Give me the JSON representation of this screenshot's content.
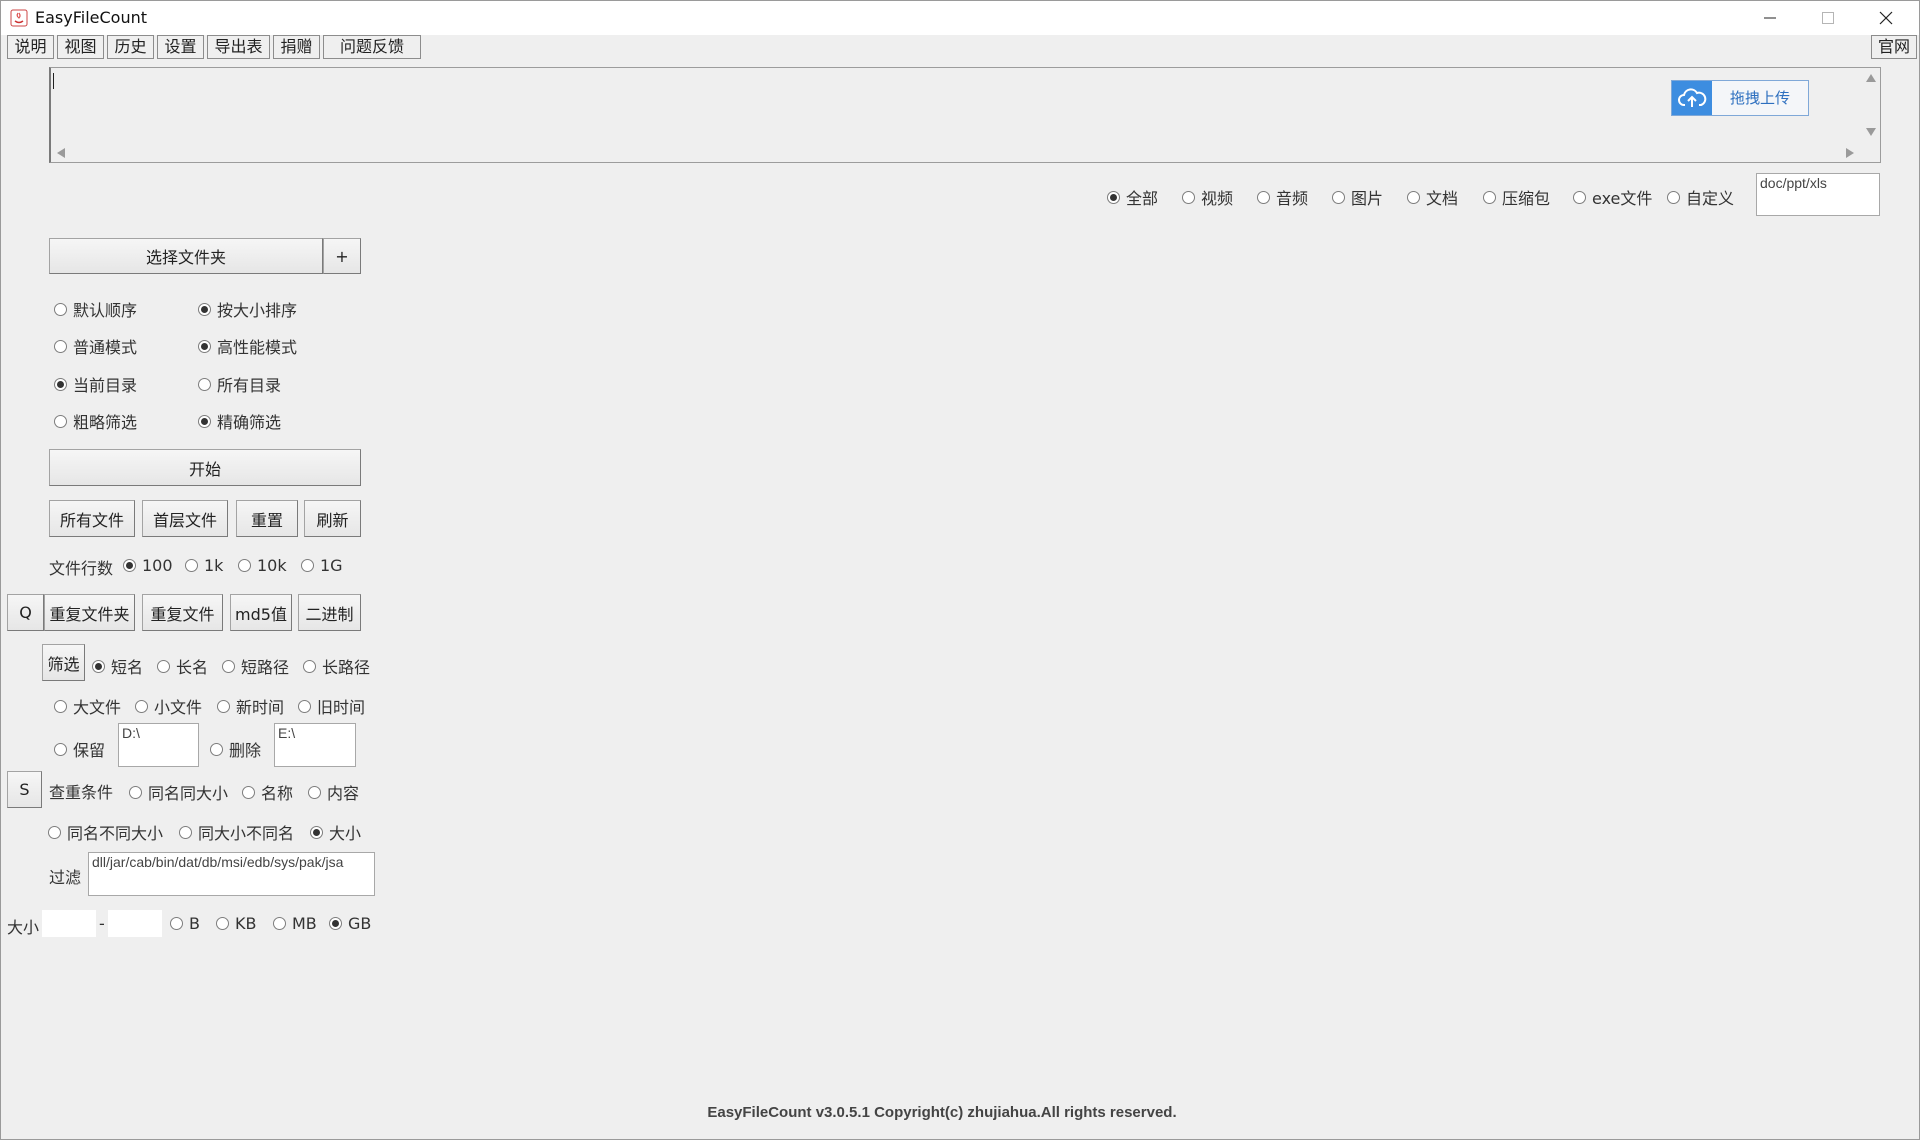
{
  "window": {
    "title": "EasyFileCount"
  },
  "menu": {
    "items": [
      "说明",
      "视图",
      "历史",
      "设置",
      "导出表",
      "捐赠",
      "问题反馈"
    ],
    "website": "官网"
  },
  "upload": {
    "button_label": "拖拽上传"
  },
  "filetype": {
    "options": [
      "全部",
      "视频",
      "音频",
      "图片",
      "文档",
      "压缩包",
      "exe文件",
      "自定义"
    ],
    "selected": "全部",
    "custom_value": "doc/ppt/xls"
  },
  "folder": {
    "select_label": "选择文件夹",
    "add_label": "+"
  },
  "options": {
    "row1": [
      "默认顺序",
      "按大小排序"
    ],
    "row2": [
      "普通模式",
      "高性能模式"
    ],
    "row3": [
      "当前目录",
      "所有目录"
    ],
    "row4": [
      "粗略筛选",
      "精确筛选"
    ]
  },
  "actions": {
    "start": "开始",
    "all_files": "所有文件",
    "first_files": "首层文件",
    "reset": "重置",
    "refresh": "刷新"
  },
  "line_count": {
    "label": "文件行数",
    "options": [
      "100",
      "1k",
      "10k",
      "1G"
    ]
  },
  "dup": {
    "q": "Q",
    "dup_folder": "重复文件夹",
    "dup_file": "重复文件",
    "md5": "md5值",
    "binary": "二进制"
  },
  "filter": {
    "button": "筛选",
    "name_opts": [
      "短名",
      "长名",
      "短路径",
      "长路径"
    ],
    "size_opts": [
      "大文件",
      "小文件",
      "新时间",
      "旧时间"
    ],
    "keep": "保留",
    "keep_value": "D:\\",
    "delete": "删除",
    "delete_value": "E:\\"
  },
  "check": {
    "s": "S",
    "label": "查重条件",
    "opts1": [
      "同名同大小",
      "名称",
      "内容"
    ],
    "opts2": [
      "同名不同大小",
      "同大小不同名",
      "大小"
    ]
  },
  "exclude": {
    "label": "过滤",
    "value": "dll/jar/cab/bin/dat/db/msi/edb/sys/pak/jsa"
  },
  "size": {
    "label": "大小",
    "dash": "-",
    "units": [
      "B",
      "KB",
      "MB",
      "GB"
    ]
  },
  "footer": {
    "text": "EasyFileCount v3.0.5.1 Copyright(c) zhujiahua.All rights reserved."
  }
}
